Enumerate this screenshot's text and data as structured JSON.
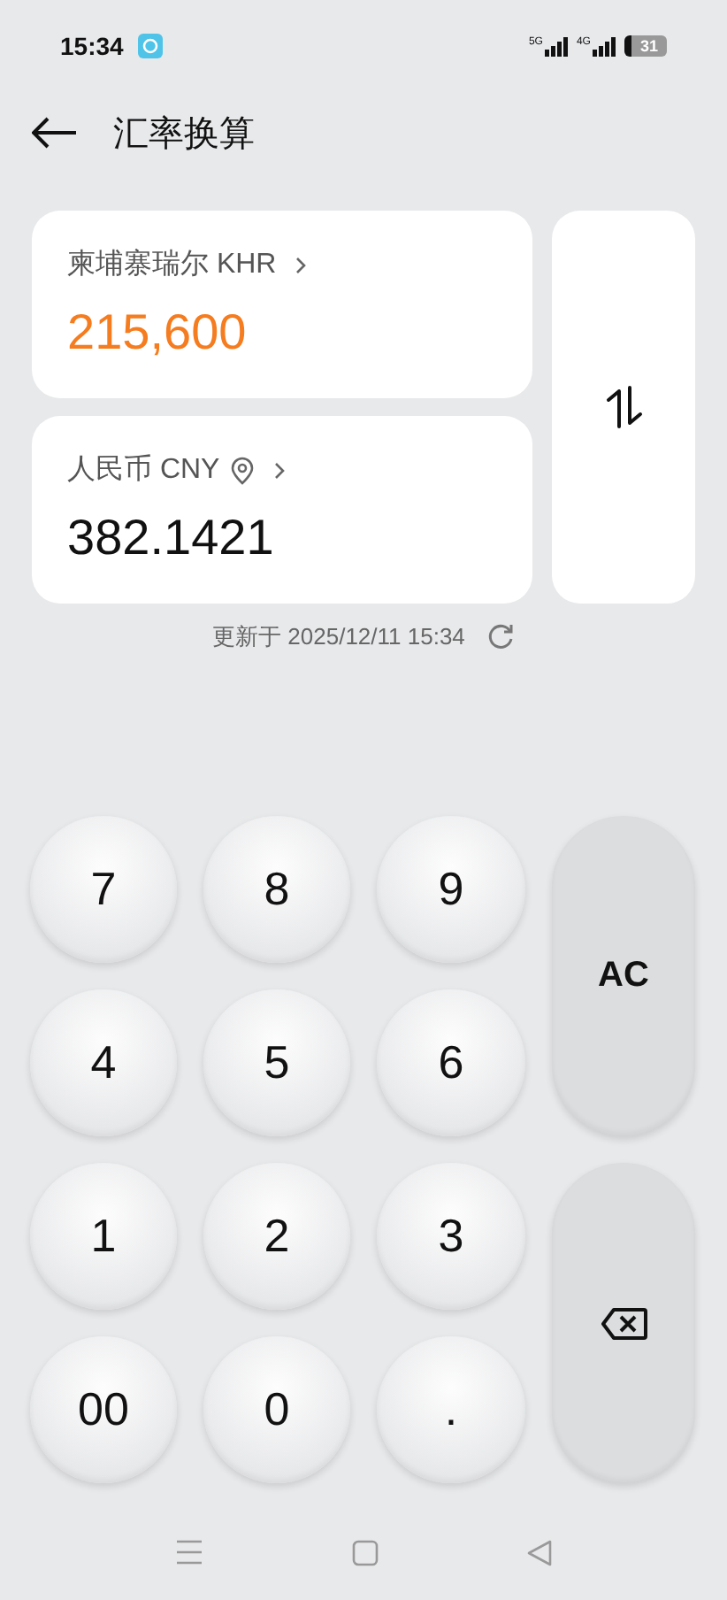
{
  "status_bar": {
    "time": "15:34",
    "signals": [
      "5G",
      "4G"
    ],
    "battery": "31"
  },
  "header": {
    "title": "汇率换算"
  },
  "from": {
    "currency": "柬埔寨瑞尔 KHR",
    "amount": "215,600",
    "located": false
  },
  "to": {
    "currency": "人民币 CNY",
    "amount": "382.1421",
    "located": true
  },
  "updated": "更新于 2025/12/11 15:34",
  "keys": [
    {
      "label": "7",
      "kind": "digit"
    },
    {
      "label": "8",
      "kind": "digit"
    },
    {
      "label": "9",
      "kind": "digit"
    },
    {
      "label": "AC",
      "kind": "clear"
    },
    {
      "label": "4",
      "kind": "digit"
    },
    {
      "label": "5",
      "kind": "digit"
    },
    {
      "label": "6",
      "kind": "digit"
    },
    {
      "label": "1",
      "kind": "digit"
    },
    {
      "label": "2",
      "kind": "digit"
    },
    {
      "label": "3",
      "kind": "digit"
    },
    {
      "kind": "backspace"
    },
    {
      "label": "00",
      "kind": "digit"
    },
    {
      "label": "0",
      "kind": "digit"
    },
    {
      "label": ".",
      "kind": "digit"
    }
  ]
}
